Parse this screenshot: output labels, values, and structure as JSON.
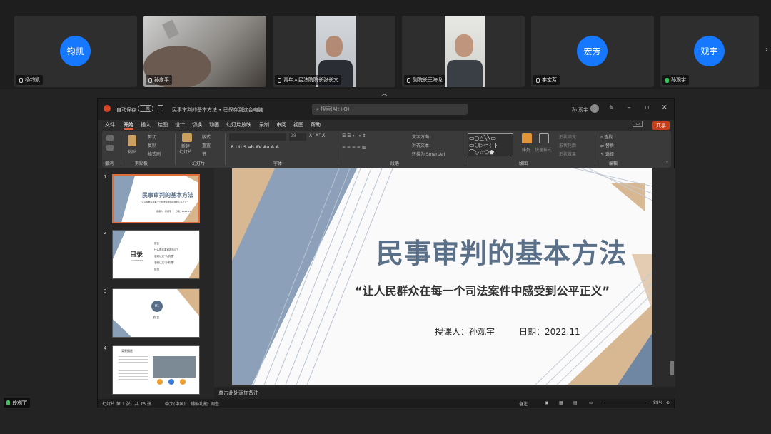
{
  "participants": [
    {
      "name": "杨钧凯",
      "avatar": "钧凯",
      "mic": "off"
    },
    {
      "name": "孙彦平",
      "avatar": "",
      "mic": "off"
    },
    {
      "name": "青年人民法院院长张长文",
      "avatar": "",
      "mic": "off"
    },
    {
      "name": "副院长王海龙",
      "avatar": "",
      "mic": "off"
    },
    {
      "name": "李宏芳",
      "avatar": "宏芳",
      "mic": "off"
    },
    {
      "name": "孙观宇",
      "avatar": "观宇",
      "mic": "on"
    }
  ],
  "self_name": "孙观宇",
  "ppt": {
    "autosave_label": "自动保存",
    "autosave_state": "关",
    "doc_title": "民事审判的基本方法 • 已保存到这台电脑",
    "search_placeholder": "搜索(Alt+Q)",
    "user": "孙 观宇",
    "menu": [
      "文件",
      "开始",
      "插入",
      "绘图",
      "设计",
      "切换",
      "动画",
      "幻灯片放映",
      "录制",
      "审阅",
      "视图",
      "帮助"
    ],
    "share_label": "共享",
    "ribbon": {
      "groups": [
        "撤消",
        "剪贴板",
        "幻灯片",
        "字体",
        "段落",
        "绘图",
        "编辑"
      ],
      "paste": "粘贴",
      "clip": [
        "剪切",
        "复制",
        "格式刷"
      ],
      "new_slide": "新建\n幻灯片",
      "slide_items": [
        "版式",
        "重置",
        "节"
      ],
      "font_size": "28",
      "para_items": [
        "文字方向",
        "对齐文本",
        "转换为 SmartArt"
      ],
      "arrange": "排列",
      "quick_styles": "快速样式",
      "shape_items": [
        "形状填充",
        "形状轮廓",
        "形状效果"
      ],
      "edit_items": [
        "查找",
        "替换",
        "选择"
      ]
    },
    "slides": [
      {
        "num": "1",
        "title": "民事审判的基本方法",
        "sub": "“让人民群众在每一个司法案件中感受到公平正义”",
        "foot": "授课人：孙观宇      日期：2022.11"
      },
      {
        "num": "2",
        "title": "目录",
        "en": "CONTENTS",
        "items": [
          "前言",
          "什么是民事审判方法？",
          "准确认定“大前提”",
          "准确认定“小前提”",
          "结语"
        ]
      },
      {
        "num": "3",
        "badge": "01",
        "heading": "前 言"
      },
      {
        "num": "4",
        "heading": "背景描述"
      }
    ],
    "main_slide": {
      "title": "民事审判的基本方法",
      "subtitle": "“让人民群众在每一个司法案件中感受到公平正义”",
      "lecturer": "授课人：孙观宇",
      "date": "日期：2022.11"
    },
    "notes_placeholder": "单击此处添加备注",
    "status": {
      "slide_info": "幻灯片 第 1 张，共 75 张",
      "lang": "中文(中国)",
      "accessibility": "辅助功能: 调查",
      "notes_btn": "备注",
      "zoom": "88%"
    },
    "colors": {
      "accent": "#c43e1c",
      "slide_blue": "#5a6f88",
      "slide_tan": "#d9b58e"
    }
  }
}
